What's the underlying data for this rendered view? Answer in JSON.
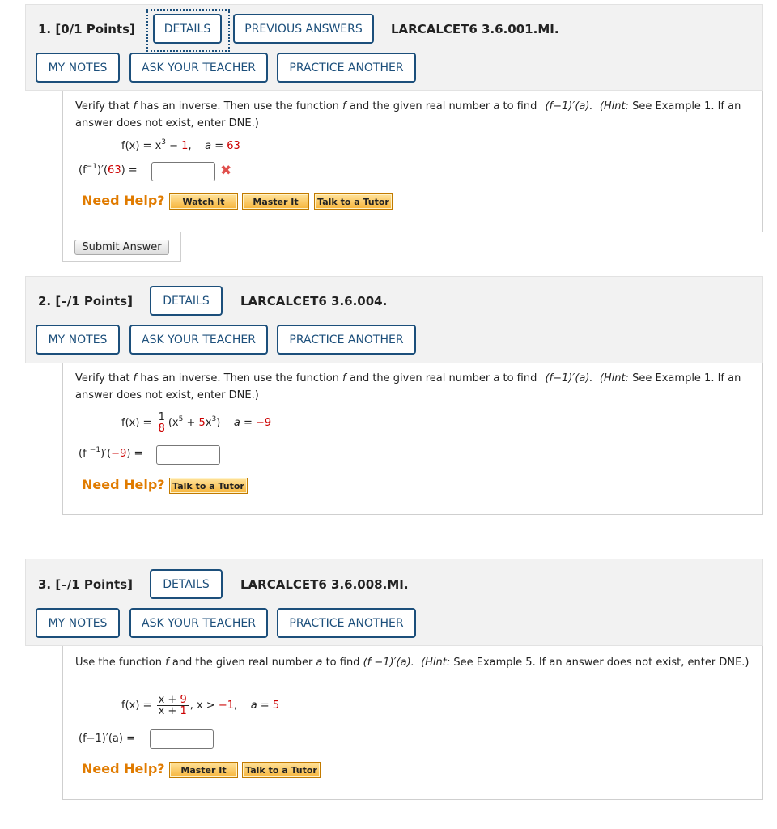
{
  "buttons": {
    "details": "DETAILS",
    "previous_answers": "PREVIOUS ANSWERS",
    "my_notes": "MY NOTES",
    "ask_teacher": "ASK YOUR TEACHER",
    "practice_another": "PRACTICE ANOTHER",
    "need_help": "Need Help?",
    "watch_it": "Watch It",
    "master_it": "Master It",
    "talk_tutor": "Talk to a Tutor",
    "submit_answer": "Submit Answer"
  },
  "questions": [
    {
      "title": "1.  [0/1 Points]",
      "code": "LARCALCET6 3.6.001.MI.",
      "prompt_part1": "Verify that ",
      "prompt_part2": " has an inverse. Then use the function ",
      "prompt_part3": " and the given real number ",
      "prompt_part4": " to find ",
      "prompt_part5": "(f−1)′(a).",
      "prompt_part6": "(Hint:",
      "prompt_part7": " See Example 1. If an answer does not exist, enter DNE.)",
      "function_lhs": "f(x) = x",
      "function_exp": "3",
      "function_minus": " − ",
      "function_const": "1",
      "a_label": "a = ",
      "a_value": "63",
      "answer_lhs_a": "(f",
      "answer_lhs_exp": "−1",
      "answer_lhs_b": ")′(",
      "answer_lhs_val": "63",
      "answer_lhs_c": ") =",
      "answer_value": "",
      "status": "incorrect"
    },
    {
      "title": "2.  [–/1 Points]",
      "code": "LARCALCET6 3.6.004.",
      "prompt_part1": "Verify that ",
      "prompt_part2": " has an inverse. Then use the function ",
      "prompt_part3": " and the given real number ",
      "prompt_part4": " to find ",
      "prompt_part5": "(f−1)′(a).",
      "prompt_part6": "(Hint:",
      "prompt_part7": " See Example 1. If an answer does not exist, enter DNE.)",
      "function_lhs": "f(x) = ",
      "frac_num": "1",
      "frac_den": "8",
      "function_rest_a": "(x",
      "function_exp1": "5",
      "function_plus": " + ",
      "function_coef": "5",
      "function_x": "x",
      "function_exp2": "3",
      "function_close": ")",
      "a_label": "a = ",
      "a_value": "−9",
      "answer_lhs_a": "(f ",
      "answer_lhs_exp": "−1",
      "answer_lhs_b": ")′(",
      "answer_lhs_val": "−9",
      "answer_lhs_c": ") =",
      "answer_value": ""
    },
    {
      "title": "3.  [–/1 Points]",
      "code": "LARCALCET6 3.6.008.MI.",
      "prompt_part1": "Use the function ",
      "prompt_part2": " and the given real number ",
      "prompt_part3": " to find ",
      "prompt_part4": "(f −1)′(a).",
      "prompt_part5": "(Hint:",
      "prompt_part6": " See Example 5. If an answer does not exist, enter DNE.)",
      "function_lhs": "f(x) = ",
      "frac_num_a": "x + ",
      "frac_num_b": "9",
      "frac_den_a": "x + ",
      "frac_den_b": "1",
      "cond_a": ",   x > ",
      "cond_b": "−1",
      "cond_c": ",",
      "a_label": "a = ",
      "a_value": "5",
      "answer_lhs": "(f−1)′(a)  =",
      "answer_value": ""
    }
  ],
  "colors": {
    "accent": "#1c4f7b",
    "header_bg": "#f2f2f2",
    "red_value": "#cc0000",
    "need_help": "#e07b00",
    "incorrect": "#e0504d"
  },
  "icons": [
    "incorrect-x-icon"
  ]
}
